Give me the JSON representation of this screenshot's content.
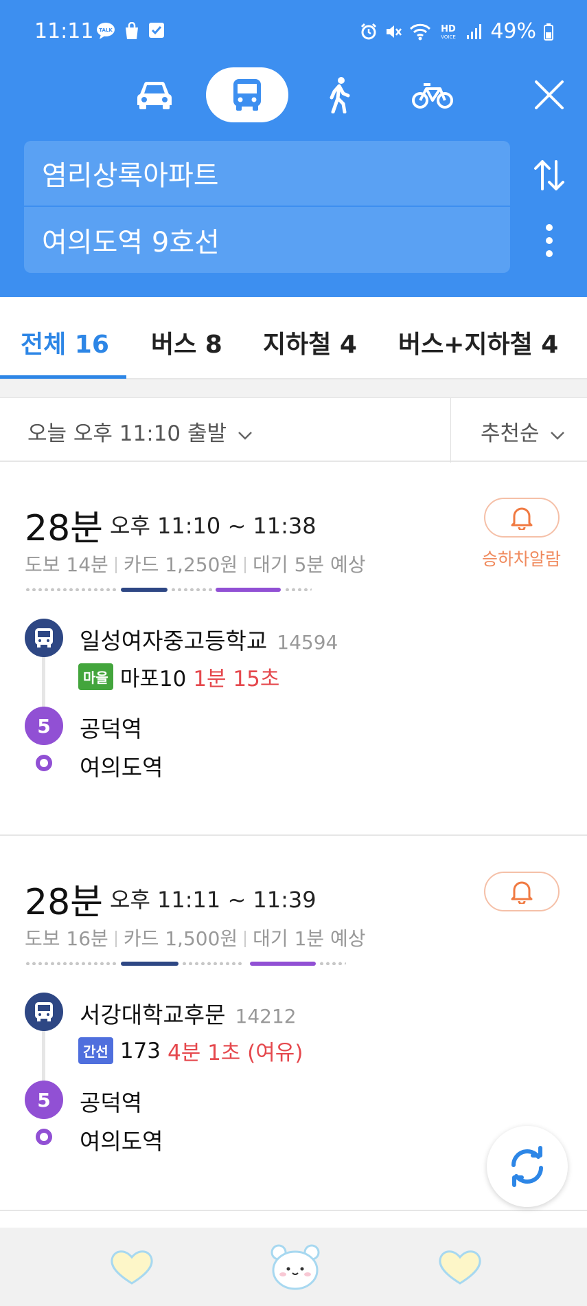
{
  "status_bar": {
    "time": "11:11",
    "battery": "49%",
    "talk_badge": "TALK",
    "hd": "HD",
    "voice": "VOICE"
  },
  "modes": {
    "car": "car-icon",
    "bus": "bus-icon",
    "walk": "walk-icon",
    "bike": "bike-icon",
    "close": "close-icon"
  },
  "search": {
    "origin": "염리상록아파트",
    "destination": "여의도역 9호선"
  },
  "tabs": [
    {
      "label": "전체 16",
      "active": true
    },
    {
      "label": "버스 8",
      "active": false
    },
    {
      "label": "지하철 4",
      "active": false
    },
    {
      "label": "버스+지하철 4",
      "active": false
    }
  ],
  "filter": {
    "departure": "오늘 오후 11:10 출발",
    "sort": "추천순"
  },
  "routes": [
    {
      "duration": "28분",
      "time_range": "오후 11:10 ~ 11:38",
      "walk": "도보 14분",
      "fare": "카드 1,250원",
      "wait": "대기 5분 예상",
      "alarm_label": "승하차알람",
      "first_stop": "일성여자중고등학교",
      "first_stop_id": "14594",
      "bus_type": "마을",
      "bus_route": "마포10",
      "bus_eta": "1분 15초",
      "transfer_line": "5",
      "transfer_station": "공덕역",
      "destination": "여의도역"
    },
    {
      "duration": "28분",
      "time_range": "오후 11:11 ~ 11:39",
      "walk": "도보 16분",
      "fare": "카드 1,500원",
      "wait": "대기 1분 예상",
      "first_stop": "서강대학교후문",
      "first_stop_id": "14212",
      "bus_type": "간선",
      "bus_route": "173",
      "bus_eta": "4분 1초 (여유)",
      "transfer_line": "5",
      "transfer_station": "공덕역",
      "destination": "여의도역"
    }
  ],
  "colors": {
    "header": "#3d8ff0",
    "active_tab": "#2d86e6",
    "bus_line": "#2e4784",
    "subway_line_5": "#9150d4",
    "eta": "#e5484d",
    "village_bus": "#43a53c",
    "trunk_bus": "#4f6fdd"
  },
  "bottom_nav": [
    "heart-icon",
    "bear-icon",
    "heart-icon"
  ]
}
